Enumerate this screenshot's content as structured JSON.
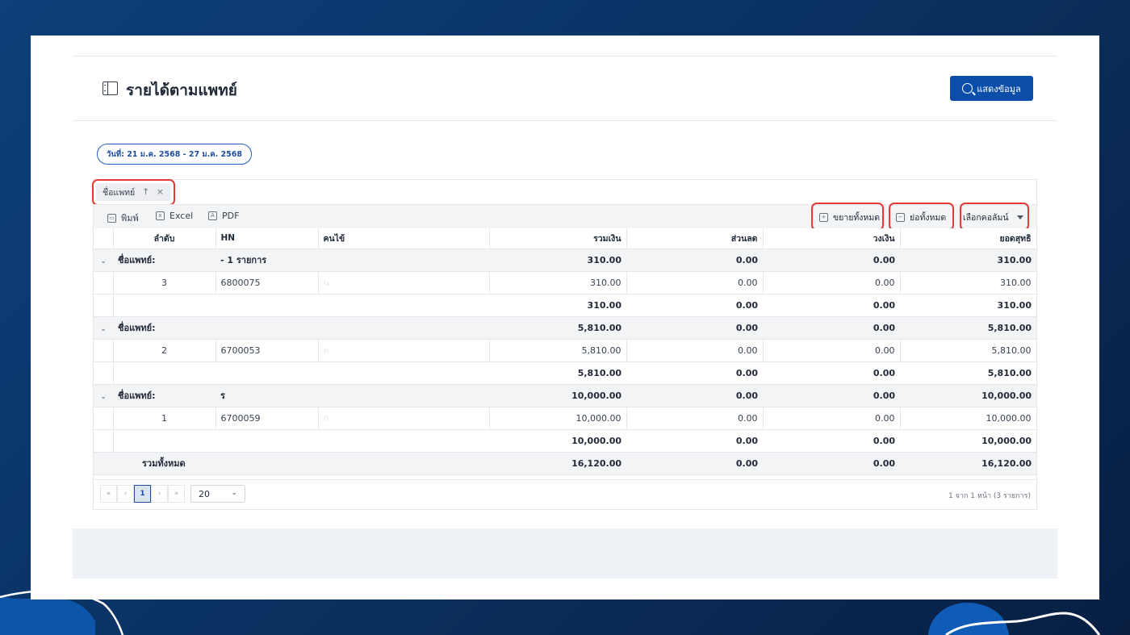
{
  "page": {
    "title": "รายได้ตามแพทย์"
  },
  "header": {
    "show_button": "แสดงข้อมูล"
  },
  "filter": {
    "date_range": "วันที่: 21 ม.ค. 2568 - 27 ม.ค. 2568"
  },
  "grouping": {
    "chip_label": "ชื่อแพทย์",
    "sort_glyph": "↑",
    "remove_glyph": "×"
  },
  "toolbar": {
    "print": "พิมพ์",
    "excel": "Excel",
    "pdf": "PDF",
    "expand_all": "ขยายทั้งหมด",
    "collapse_all": "ย่อทั้งหมด",
    "choose_columns": "เลือกคอลัมน์"
  },
  "table": {
    "columns": [
      "ลำดับ",
      "HN",
      "คนไข้",
      "รวมเงิน",
      "ส่วนลด",
      "วงเงิน",
      "ยอดสุทธิ"
    ],
    "groups": [
      {
        "label": "ชื่อแพทย์:",
        "suffix": "- 1 รายการ",
        "totals": [
          "310.00",
          "0.00",
          "0.00",
          "310.00"
        ],
        "rows": [
          {
            "no": "3",
            "hn": "6800075",
            "patient": "น",
            "amounts": [
              "310.00",
              "0.00",
              "0.00",
              "310.00"
            ]
          }
        ],
        "subtotal": [
          "310.00",
          "0.00",
          "0.00",
          "310.00"
        ]
      },
      {
        "label": "ชื่อแพทย์:",
        "suffix": "",
        "totals": [
          "5,810.00",
          "0.00",
          "0.00",
          "5,810.00"
        ],
        "rows": [
          {
            "no": "2",
            "hn": "6700053",
            "patient": "ค",
            "amounts": [
              "5,810.00",
              "0.00",
              "0.00",
              "5,810.00"
            ]
          }
        ],
        "subtotal": [
          "5,810.00",
          "0.00",
          "0.00",
          "5,810.00"
        ]
      },
      {
        "label": "ชื่อแพทย์:",
        "suffix": "ร",
        "totals": [
          "10,000.00",
          "0.00",
          "0.00",
          "10,000.00"
        ],
        "rows": [
          {
            "no": "1",
            "hn": "6700059",
            "patient": "ก",
            "amounts": [
              "10,000.00",
              "0.00",
              "0.00",
              "10,000.00"
            ]
          }
        ],
        "subtotal": [
          "10,000.00",
          "0.00",
          "0.00",
          "10,000.00"
        ]
      }
    ],
    "grand_total_label": "รวมทั้งหมด",
    "grand_total": [
      "16,120.00",
      "0.00",
      "0.00",
      "16,120.00"
    ]
  },
  "pager": {
    "first": "«",
    "prev": "‹",
    "current": "1",
    "next": "›",
    "last": "»",
    "page_size": "20",
    "info": "1 จาก 1 หน้า (3 รายการ)"
  },
  "icons": [
    "sidebar-panel-icon",
    "search-icon",
    "printer-icon",
    "excel-icon",
    "pdf-icon",
    "expand-all-icon",
    "collapse-all-icon",
    "chevron-down-icon"
  ],
  "colors": {
    "primary": "#0b4eaa",
    "highlight": "#e53935",
    "background": "#0a2f5e"
  }
}
